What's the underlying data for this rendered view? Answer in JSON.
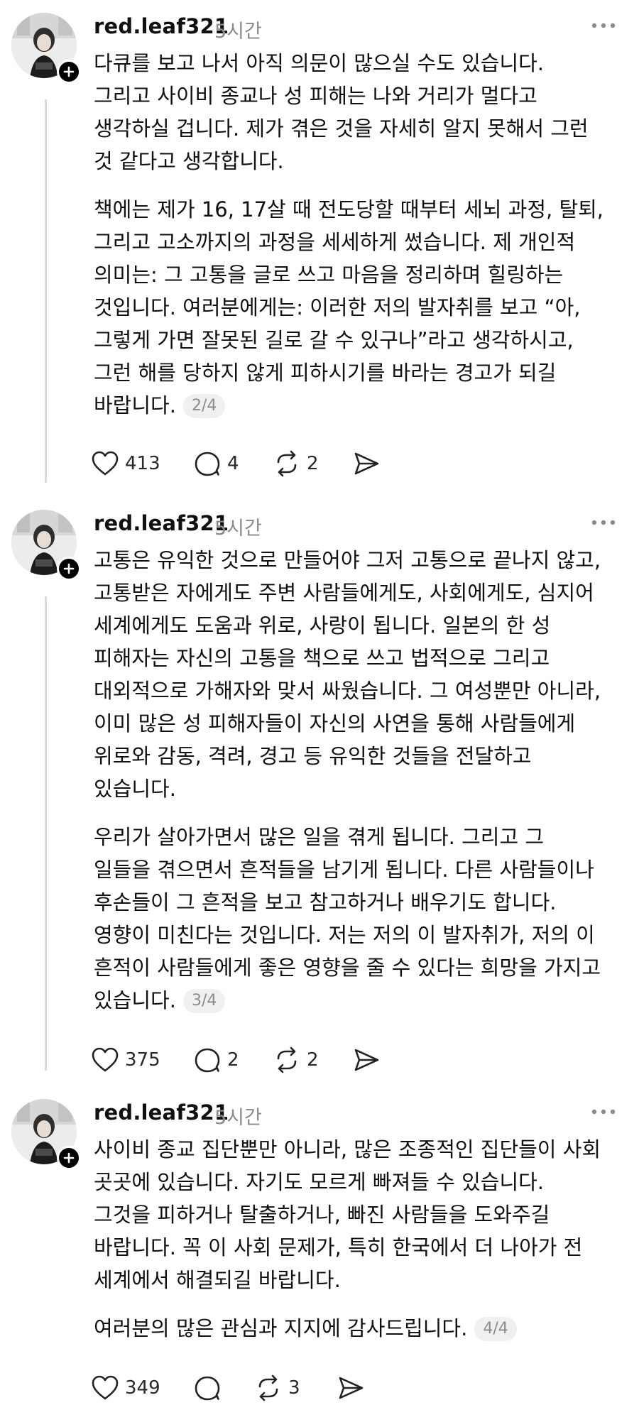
{
  "posts": [
    {
      "username": "red.leaf321",
      "time": "5시간",
      "paragraphs": [
        "다큐를 보고 나서 아직 의문이 많으실 수도 있습니다.\n그리고 사이비 종교나 성 피해는 나와 거리가 멀다고\n생각하실 겁니다. 제가 겪은 것을 자세히 알지 못해서 그런\n것 같다고 생각합니다.",
        "책에는 제가 16, 17살 때 전도당할 때부터 세뇌 과정, 탈퇴,\n그리고 고소까지의 과정을 세세하게 썼습니다. 제 개인적\n의미는: 그 고통을 글로 쓰고 마음을 정리하며 힐링하는\n것입니다. 여러분에게는: 이러한 저의 발자취를 보고 “아,\n그렇게 가면 잘못된 길로 갈 수 있구나”라고 생각하시고,\n그런 해를 당하지 않게 피하시기를 바라는 경고가 되길\n바랍니다."
      ],
      "counter": "2/4",
      "likes": "413",
      "replies": "4",
      "reposts": "2"
    },
    {
      "username": "red.leaf321",
      "time": "5시간",
      "paragraphs": [
        "고통은 유익한 것으로 만들어야 그저 고통으로 끝나지 않고,\n고통받은 자에게도 주변 사람들에게도, 사회에게도, 심지어\n세계에게도 도움과 위로, 사랑이 됩니다. 일본의 한 성\n피해자는 자신의 고통을 책으로 쓰고 법적으로 그리고\n대외적으로 가해자와 맞서 싸웠습니다. 그 여성뿐만 아니라,\n이미 많은 성 피해자들이 자신의 사연을 통해 사람들에게\n위로와 감동, 격려, 경고 등 유익한 것들을 전달하고\n있습니다.",
        "우리가 살아가면서 많은 일을 겪게 됩니다. 그리고 그\n일들을 겪으면서 흔적들을 남기게 됩니다. 다른 사람들이나\n후손들이 그 흔적을 보고 참고하거나 배우기도 합니다.\n영향이 미친다는 것입니다. 저는 저의 이 발자취가, 저의 이\n흔적이 사람들에게 좋은 영향을 줄 수 있다는 희망을 가지고\n있습니다."
      ],
      "counter": "3/4",
      "likes": "375",
      "replies": "2",
      "reposts": "2"
    },
    {
      "username": "red.leaf321",
      "time": "5시간",
      "paragraphs": [
        "사이비 종교 집단뿐만 아니라, 많은 조종적인 집단들이 사회\n곳곳에 있습니다. 자기도 모르게 빠져들 수 있습니다.\n그것을 피하거나 탈출하거나, 빠진 사람들을 도와주길\n바랍니다. 꼭 이 사회 문제가, 특히 한국에서 더 나아가 전\n세계에서 해결되길 바랍니다.",
        "여러분의 많은 관심과 지지에 감사드립니다."
      ],
      "counter": "4/4",
      "likes": "349",
      "replies": "",
      "reposts": "3"
    }
  ],
  "icons": {
    "like": "heart-icon",
    "reply": "comment-icon",
    "repost": "repost-icon",
    "share": "send-icon",
    "more": "more-dots-icon",
    "follow": "plus-icon"
  }
}
